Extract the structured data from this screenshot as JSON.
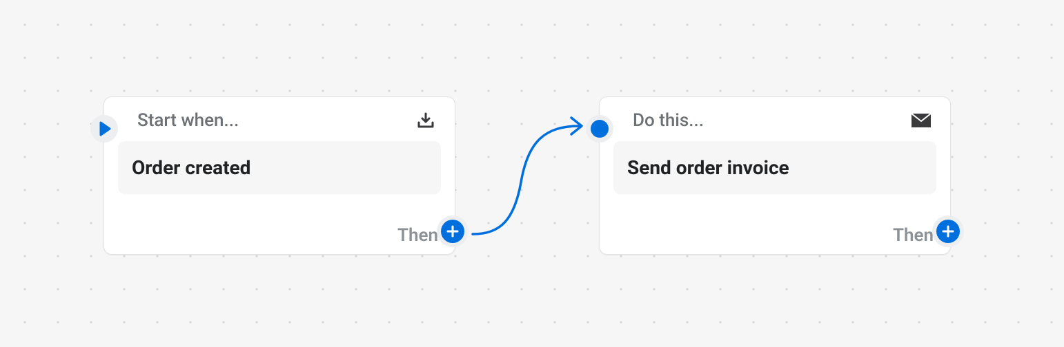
{
  "trigger_node": {
    "header_label": "Start when...",
    "title": "Order created",
    "footer_label": "Then"
  },
  "action_node": {
    "header_label": "Do this...",
    "title": "Send order invoice",
    "footer_label": "Then"
  },
  "colors": {
    "accent": "#006fde",
    "icon_dark": "#3a3a3c",
    "text_subdued": "#6d7175"
  }
}
